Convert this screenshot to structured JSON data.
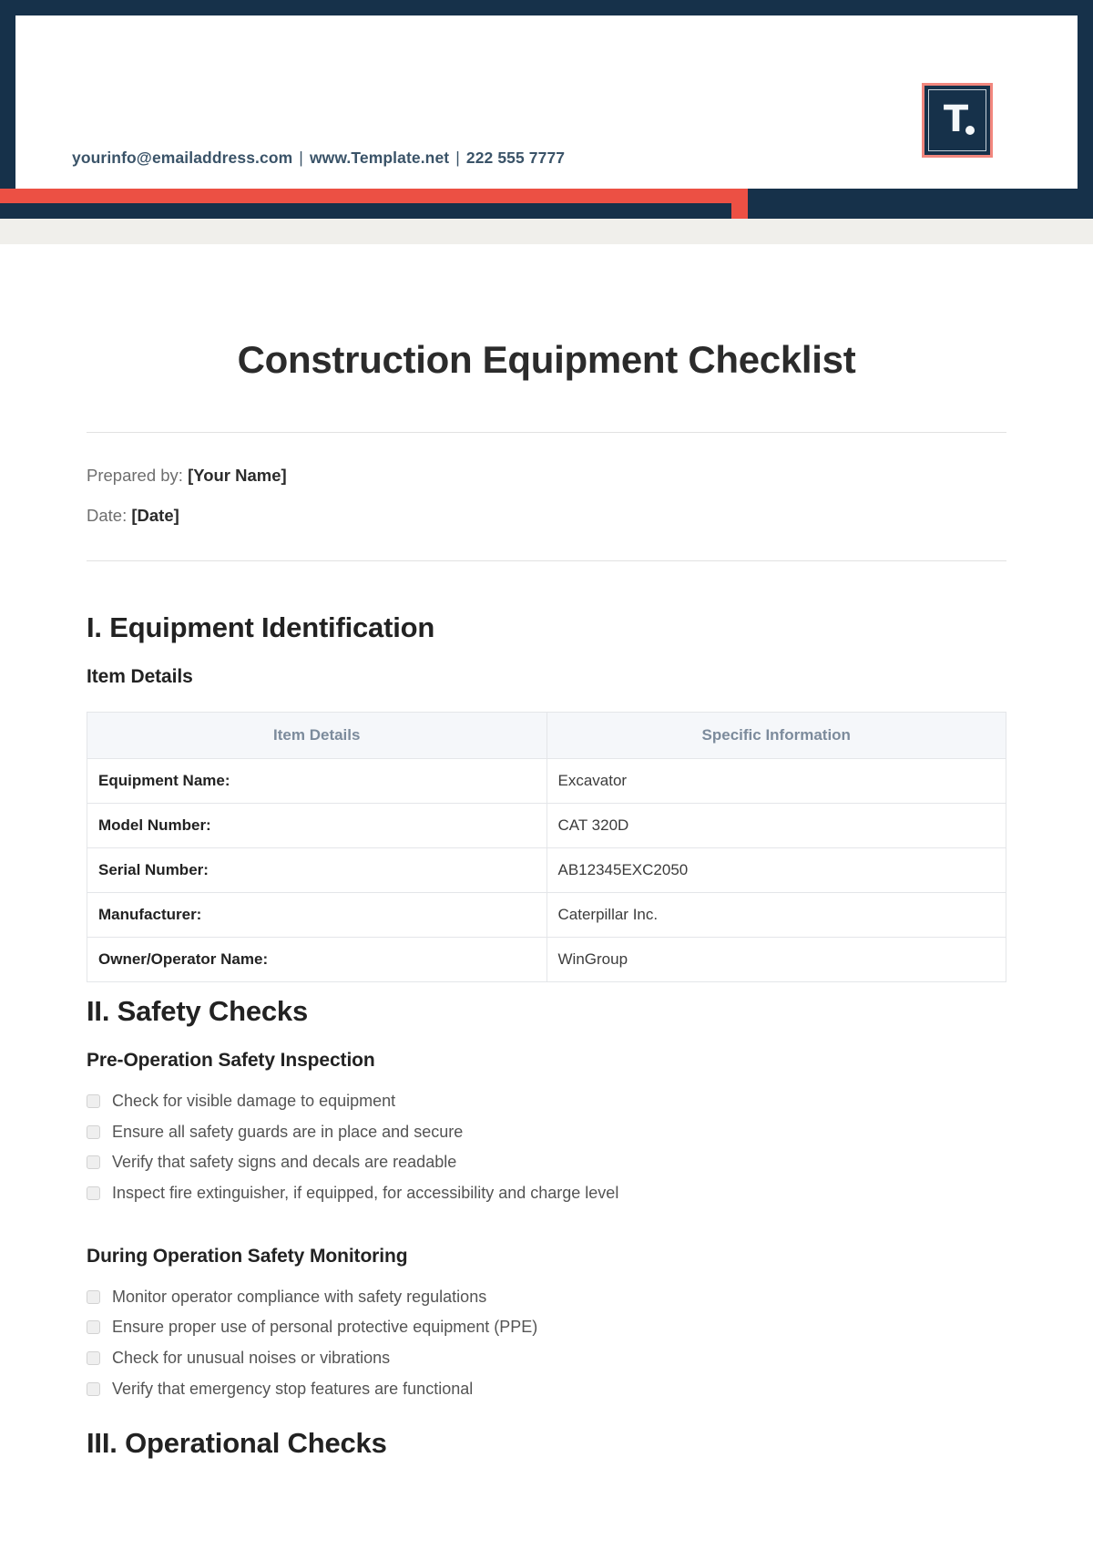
{
  "header": {
    "contact": {
      "email": "yourinfo@emailaddress.com",
      "separator1": "|",
      "website": "www.Template.net",
      "separator2": "|",
      "phone": "222 555 7777"
    },
    "logo_letter": "T",
    "colors": {
      "navy": "#16314a",
      "red": "#ec5044",
      "logo_border": "#f2877e"
    }
  },
  "document": {
    "title": "Construction Equipment Checklist",
    "meta": [
      {
        "label": "Prepared by:",
        "value": "[Your Name]"
      },
      {
        "label": "Date:",
        "value": "[Date]"
      }
    ]
  },
  "sections": [
    {
      "heading": "I. Equipment Identification",
      "subheading": "Item Details",
      "table": {
        "columns": [
          "Item Details",
          "Specific Information"
        ],
        "rows": [
          {
            "key": "Equipment Name:",
            "value": "Excavator"
          },
          {
            "key": "Model Number:",
            "value": "CAT 320D"
          },
          {
            "key": "Serial Number:",
            "value": "AB12345EXC2050"
          },
          {
            "key": "Manufacturer:",
            "value": "Caterpillar Inc."
          },
          {
            "key": "Owner/Operator Name:",
            "value": "WinGroup"
          }
        ]
      }
    },
    {
      "heading": "II. Safety Checks",
      "groups": [
        {
          "subheading": "Pre-Operation Safety Inspection",
          "items": [
            "Check for visible damage to equipment",
            "Ensure all safety guards are in place and secure",
            "Verify that safety signs and decals are readable",
            "Inspect fire extinguisher, if equipped, for accessibility and charge level"
          ]
        },
        {
          "subheading": "During Operation Safety Monitoring",
          "items": [
            "Monitor operator compliance with safety regulations",
            "Ensure proper use of personal protective equipment (PPE)",
            "Check for unusual noises or vibrations",
            "Verify that emergency stop features are functional"
          ]
        }
      ]
    },
    {
      "heading": "III. Operational Checks"
    }
  ]
}
